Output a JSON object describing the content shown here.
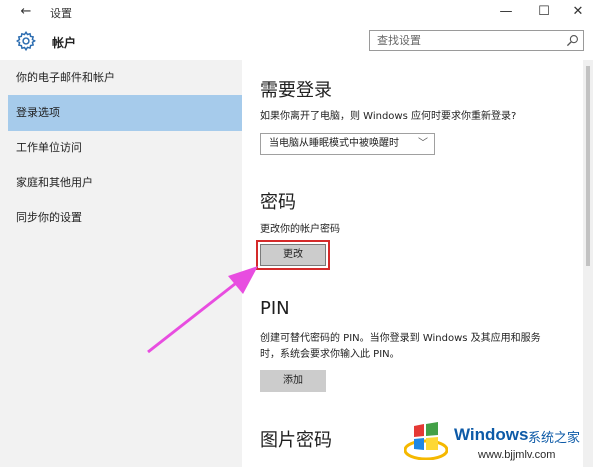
{
  "window": {
    "title": "设置",
    "back_glyph": "←",
    "min_glyph": "—",
    "max_glyph": "☐",
    "close_glyph": "✕"
  },
  "header": {
    "title": "帐户",
    "icon": "gear-icon"
  },
  "search": {
    "placeholder": "查找设置",
    "value": "",
    "icon": "search-icon"
  },
  "sidebar": {
    "items": [
      {
        "label": "你的电子邮件和帐户"
      },
      {
        "label": "登录选项",
        "selected": true
      },
      {
        "label": "工作单位访问"
      },
      {
        "label": "家庭和其他用户"
      },
      {
        "label": "同步你的设置"
      }
    ]
  },
  "content": {
    "require_signin": {
      "heading": "需要登录",
      "description": "如果你离开了电脑，则 Windows 应何时要求你重新登录?",
      "dropdown_value": "当电脑从睡眠模式中被唤醒时",
      "dropdown_chevron": "﹀"
    },
    "password": {
      "heading": "密码",
      "description": "更改你的帐户密码",
      "button": "更改"
    },
    "pin": {
      "heading": "PIN",
      "description_line1": "创建可替代密码的 PIN。当你登录到 Windows 及其应用和服务",
      "description_line2": "时，系统会要求你输入此 PIN。",
      "button": "添加"
    },
    "picture_password": {
      "heading": "图片密码"
    }
  },
  "colors": {
    "sidebar_bg": "#f2f2f2",
    "selected_bg": "#a6cbeb",
    "button_bg": "#cccccc",
    "highlight_border": "#d42a2a",
    "annotation_arrow": "#e84de0"
  },
  "watermark": {
    "brand": "Windows",
    "brand_cn": "系统之家",
    "url": "www.bjjmlv.com"
  }
}
